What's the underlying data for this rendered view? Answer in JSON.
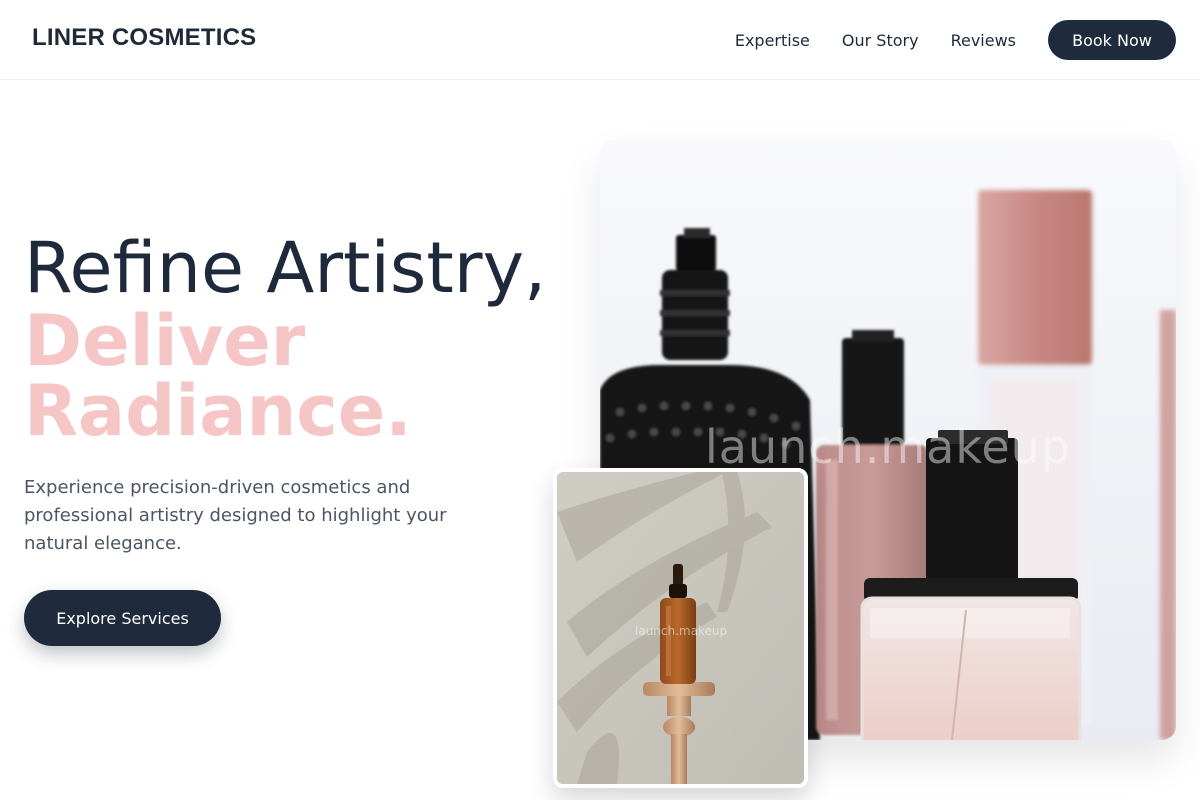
{
  "brand": {
    "logo": "LINER COSMETICS"
  },
  "nav": {
    "links": [
      "Expertise",
      "Our Story",
      "Reviews"
    ],
    "cta": "Book Now"
  },
  "hero": {
    "title_line1": "Refine Artistry,",
    "accent_line1": "Deliver",
    "accent_line2": "Radiance.",
    "description": "Experience precision-driven cosmetics and professional artistry designed to highlight your natural elegance.",
    "button": "Explore Services"
  },
  "images": {
    "main_watermark": "launch.makeup",
    "small_watermark": "launch.makeup"
  },
  "colors": {
    "primary_dark": "#1f2a3c",
    "accent_pink": "#f6c6c6",
    "text_body": "#4b5563"
  }
}
